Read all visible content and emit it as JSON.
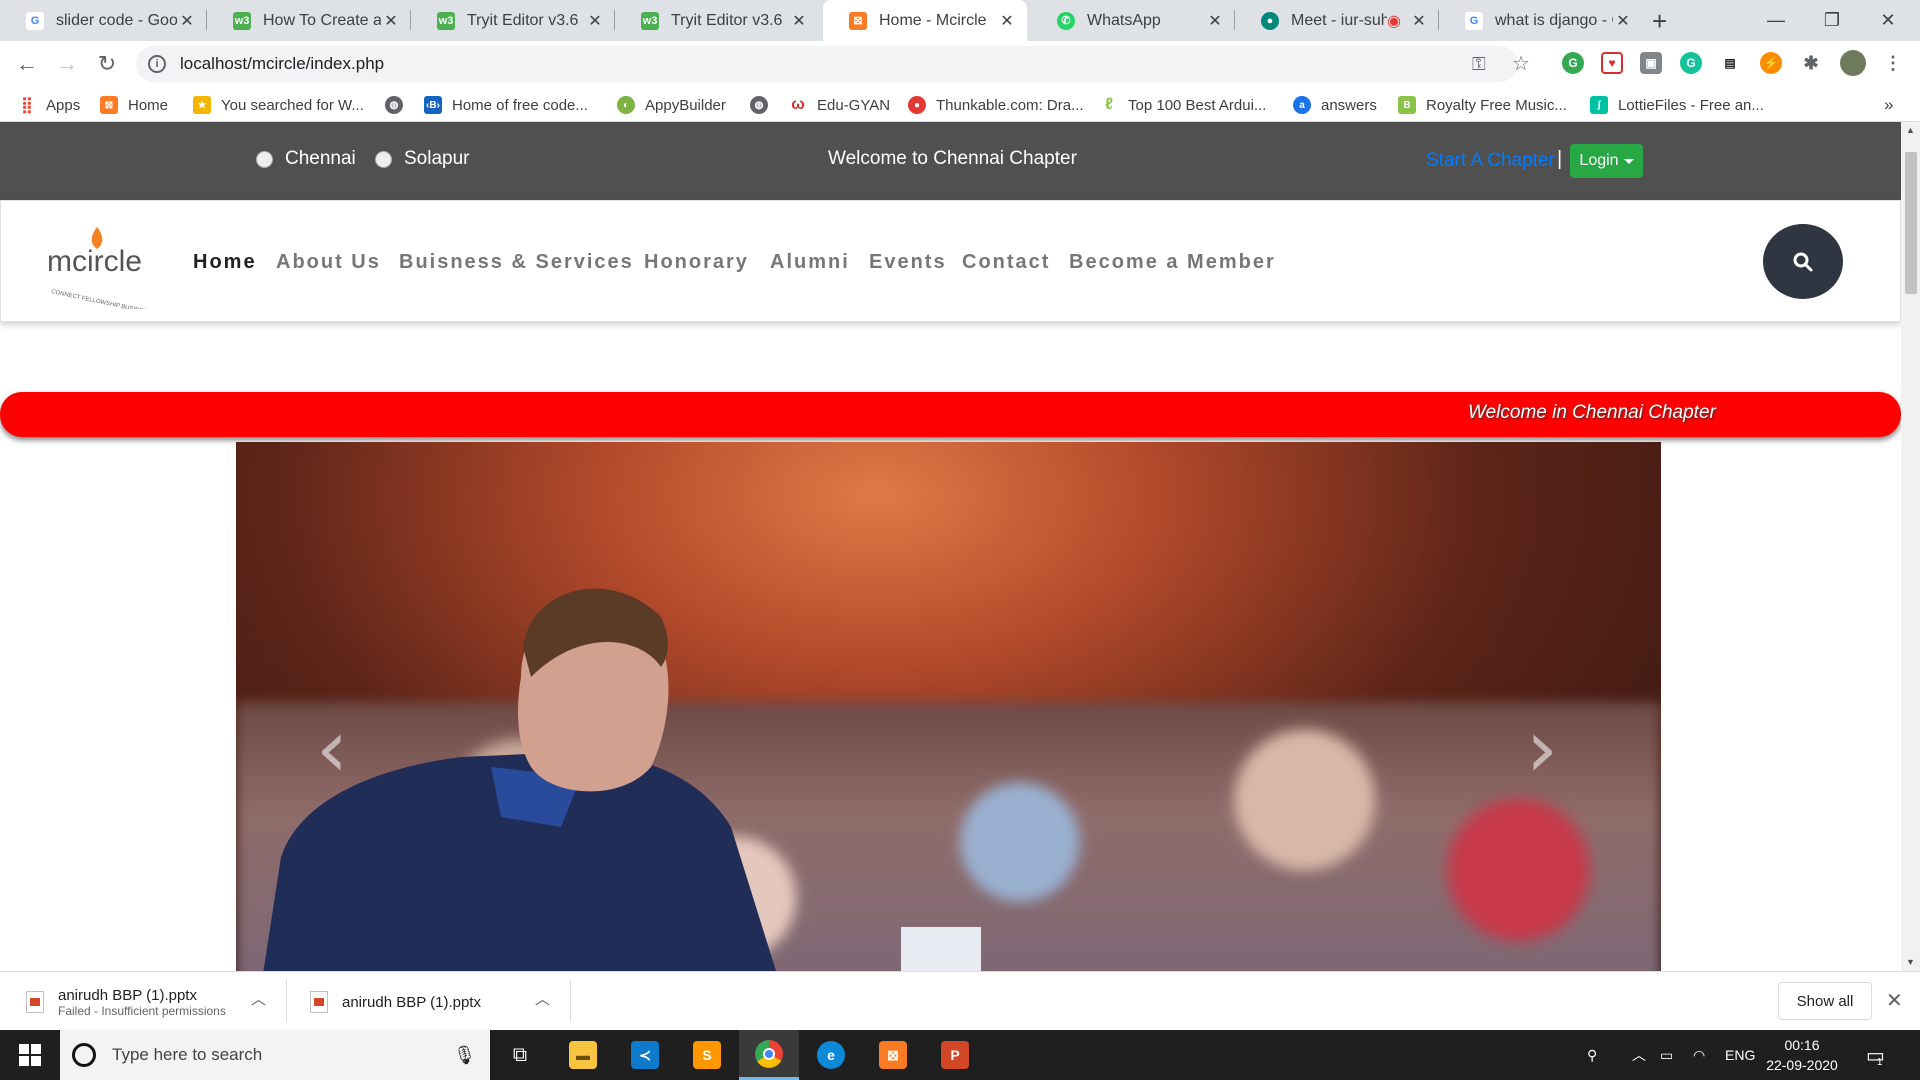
{
  "browser": {
    "tabs": [
      {
        "label": "slider code - Goog",
        "favicon": "google-icon",
        "color": "#4285f4",
        "active": false
      },
      {
        "label": "How To Create a Li",
        "favicon": "w3schools-icon",
        "color": "#4caf50",
        "active": false
      },
      {
        "label": "Tryit Editor v3.6",
        "favicon": "w3schools-icon",
        "color": "#4caf50",
        "active": false
      },
      {
        "label": "Tryit Editor v3.6",
        "favicon": "w3schools-icon",
        "color": "#4caf50",
        "active": false
      },
      {
        "label": "Home - Mcircle",
        "favicon": "xampp-icon",
        "color": "#fb7a24",
        "active": true
      },
      {
        "label": "WhatsApp",
        "favicon": "whatsapp-icon",
        "color": "#25d366",
        "active": false
      },
      {
        "label": "Meet - iur-suh",
        "favicon": "meet-icon",
        "color": "#00897b",
        "active": false
      },
      {
        "label": "what is django - G",
        "favicon": "google-icon",
        "color": "#4285f4",
        "active": false
      }
    ],
    "new_tab_symbol": "+",
    "url": "localhost/mcircle/index.php",
    "bookmarks": [
      {
        "label": "Apps",
        "icon": "apps-grid-icon",
        "color": "#ea4335"
      },
      {
        "label": "Home",
        "icon": "xampp-icon",
        "color": "#fb7a24"
      },
      {
        "label": "You searched for W...",
        "icon": "medal-icon",
        "color": "#f4b400"
      },
      {
        "label": "",
        "icon": "globe-icon",
        "color": "#5f6368"
      },
      {
        "label": "Home of free code...",
        "icon": "code-icon",
        "color": "#1565c0"
      },
      {
        "label": "AppyBuilder",
        "icon": "appybuilder-icon",
        "color": "#7cb342"
      },
      {
        "label": "",
        "icon": "globe-icon",
        "color": "#5f6368"
      },
      {
        "label": "Edu-GYAN",
        "icon": "edugyan-icon",
        "color": "#d32f2f"
      },
      {
        "label": "Thunkable.com: Dra...",
        "icon": "thunkable-icon",
        "color": "#e53935"
      },
      {
        "label": "Top 100 Best Ardui...",
        "icon": "leaf-icon",
        "color": "#8bc34a"
      },
      {
        "label": "answers",
        "icon": "answers-icon",
        "color": "#1a73e8"
      },
      {
        "label": "Royalty Free Music...",
        "icon": "music-icon",
        "color": "#8bc34a"
      },
      {
        "label": "LottieFiles - Free an...",
        "icon": "lottie-icon",
        "color": "#00c1a2"
      }
    ],
    "more_bookmarks": "»"
  },
  "site": {
    "cities": [
      "Chennai",
      "Solapur"
    ],
    "welcome_top": "Welcome to Chennai Chapter",
    "start_chapter": "Start A Chapter",
    "separator": "|",
    "login": "Login",
    "logo_text": "mcircle",
    "logo_tagline": "CONNECT FELLOWSHIP BUSINESS",
    "nav": [
      "Home",
      "About Us",
      "Buisness & Services",
      "Honorary",
      "Alumni",
      "Events",
      "Contact",
      "Become a Member"
    ],
    "marquee": "Welcome in Chennai Chapter",
    "carousel": {
      "prev": "‹",
      "next": "›"
    }
  },
  "downloads": {
    "items": [
      {
        "name": "anirudh BBP (1).pptx",
        "status": "Failed - Insufficient permissions"
      },
      {
        "name": "anirudh BBP (1).pptx",
        "status": ""
      }
    ],
    "show_all": "Show all",
    "close": "✕"
  },
  "taskbar": {
    "search_placeholder": "Type here to search",
    "language": "ENG",
    "time": "00:16",
    "date": "22-09-2020",
    "notification_count": "1"
  },
  "colors": {
    "topbar": "#505050",
    "login_green": "#28a745",
    "link_blue": "#007bff",
    "marquee_red": "#ff0000",
    "search_dark": "#2f3541"
  }
}
